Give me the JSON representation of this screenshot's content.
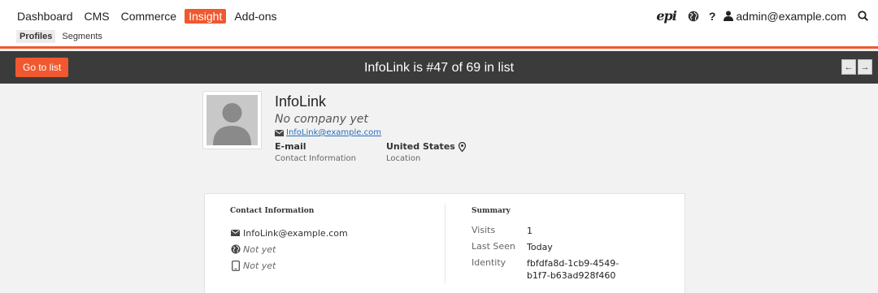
{
  "nav": {
    "menu": [
      "Dashboard",
      "CMS",
      "Commerce",
      "Insight",
      "Add-ons"
    ],
    "active": "Insight",
    "submenu": [
      "Profiles",
      "Segments"
    ],
    "help": "?",
    "user": "admin@example.com"
  },
  "listbar": {
    "go_to_list": "Go to list",
    "title": "InfoLink is #47 of 69 in list",
    "prev_icon": "←",
    "next_icon": "→"
  },
  "profile": {
    "name": "InfoLink",
    "company": "No company yet",
    "email": "InfoLink@example.com",
    "stats": [
      {
        "value": "E-mail",
        "label": "Contact Information"
      },
      {
        "value": "United States",
        "label": "Location"
      }
    ]
  },
  "contact": {
    "title": "Contact Information",
    "email": "InfoLink@example.com",
    "website": "Not yet",
    "phone": "Not yet"
  },
  "summary": {
    "title": "Summary",
    "rows": [
      {
        "key": "Visits",
        "value": "1"
      },
      {
        "key": "Last Seen",
        "value": "Today"
      },
      {
        "key": "Identity",
        "value": "fbfdfa8d-1cb9-4549-b1f7-b63ad928f460"
      }
    ]
  },
  "colors": {
    "accent": "#f0582f",
    "bar": "#3b3b3b",
    "link": "#2a6ebb"
  }
}
